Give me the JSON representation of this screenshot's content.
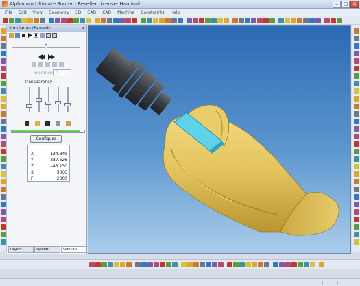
{
  "window": {
    "title": "Alphacam Ultimate Router - Reseller License: Handrail",
    "buttons": [
      "–",
      "□",
      "✕"
    ]
  },
  "menu": [
    "File",
    "Edit",
    "View",
    "Geometry",
    "3D",
    "CAD",
    "CAD",
    "Machine",
    "Constraints",
    "Help"
  ],
  "simulation_panel": {
    "title": "Simulation (Paused)",
    "close": "✕",
    "tolerance_label": "Tolerance",
    "tolerance_value": "0",
    "transparency_label": "Transparency",
    "transparency_levels": [
      0.25,
      0.5,
      0.35,
      0.4,
      0.3
    ],
    "progress": 0.93,
    "configure_label": "Configure",
    "readout": [
      {
        "label": "X",
        "value": "134.849"
      },
      {
        "label": "Y",
        "value": "237.626"
      },
      {
        "label": "Z",
        "value": "-43.230"
      },
      {
        "label": "S",
        "value": "5000"
      },
      {
        "label": "F",
        "value": "2000"
      }
    ],
    "tabs": [
      "Layers C...",
      "Operati...",
      "Simulati..."
    ]
  },
  "colors": {
    "viewport_top": "#2c69b4",
    "viewport_bottom": "#aacdec",
    "workpiece": "#e2c25c",
    "tool_holder": "#3a3d42",
    "cutter": "#5ed2e8"
  }
}
